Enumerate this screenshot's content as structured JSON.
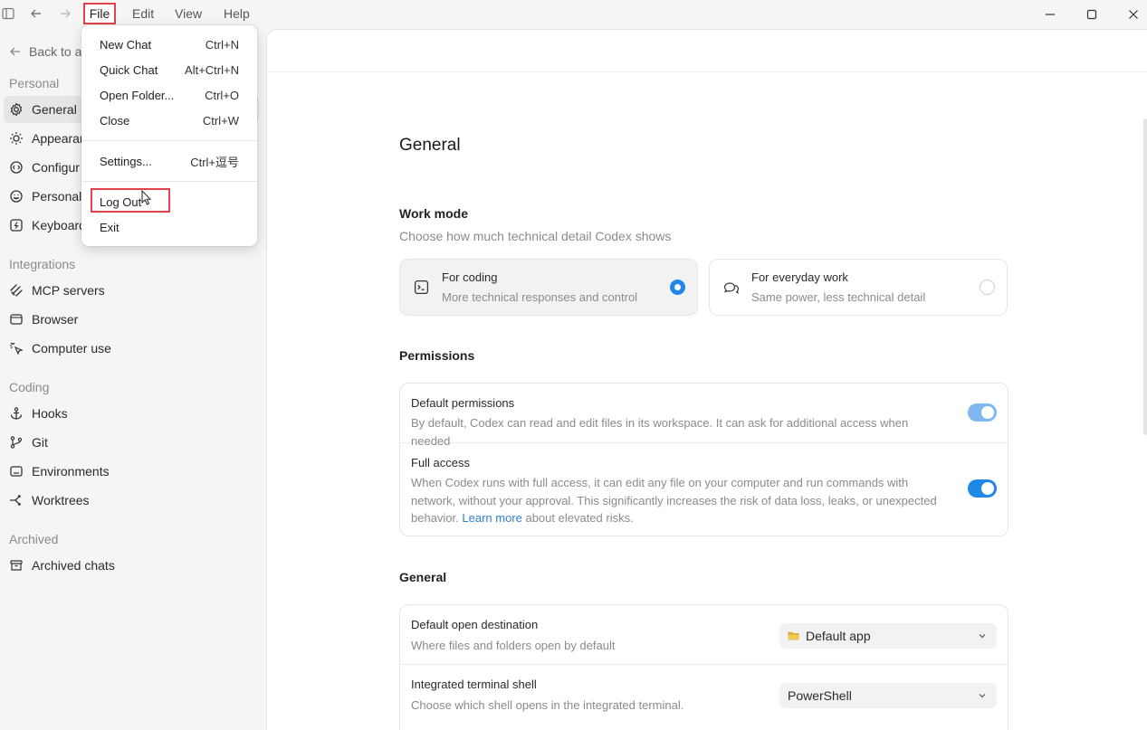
{
  "menubar": {
    "file": "File",
    "edit": "Edit",
    "view": "View",
    "help": "Help"
  },
  "file_menu": {
    "items": [
      {
        "label": "New Chat",
        "shortcut": "Ctrl+N"
      },
      {
        "label": "Quick Chat",
        "shortcut": "Alt+Ctrl+N"
      },
      {
        "label": "Open Folder...",
        "shortcut": "Ctrl+O"
      },
      {
        "label": "Close",
        "shortcut": "Ctrl+W"
      },
      {
        "label": "Settings...",
        "shortcut": "Ctrl+逗号"
      },
      {
        "label": "Log Out",
        "shortcut": ""
      },
      {
        "label": "Exit",
        "shortcut": ""
      }
    ]
  },
  "sidebar": {
    "back": "Back to a",
    "personal_label": "Personal",
    "personal": [
      {
        "label": "General",
        "icon": "gear-icon"
      },
      {
        "label": "Appearan",
        "icon": "sun-icon"
      },
      {
        "label": "Configur",
        "icon": "config-icon"
      },
      {
        "label": "Personali",
        "icon": "personalize-icon"
      },
      {
        "label": "Keyboard",
        "icon": "keyboard-icon"
      }
    ],
    "integrations_label": "Integrations",
    "integrations": [
      {
        "label": "MCP servers",
        "icon": "mcp-icon"
      },
      {
        "label": "Browser",
        "icon": "browser-icon"
      },
      {
        "label": "Computer use",
        "icon": "cursor-icon"
      }
    ],
    "coding_label": "Coding",
    "coding": [
      {
        "label": "Hooks",
        "icon": "anchor-icon"
      },
      {
        "label": "Git",
        "icon": "git-icon"
      },
      {
        "label": "Environments",
        "icon": "environment-icon"
      },
      {
        "label": "Worktrees",
        "icon": "worktree-icon"
      }
    ],
    "archived_label": "Archived",
    "archived": [
      {
        "label": "Archived chats",
        "icon": "archive-icon"
      }
    ]
  },
  "main": {
    "title": "General",
    "work_mode": {
      "heading": "Work mode",
      "subtitle": "Choose how much technical detail Codex shows",
      "coding_title": "For coding",
      "coding_desc": "More technical responses and control",
      "everyday_title": "For everyday work",
      "everyday_desc": "Same power, less technical detail"
    },
    "permissions": {
      "heading": "Permissions",
      "default_title": "Default permissions",
      "default_desc": "By default, Codex can read and edit files in its workspace. It can ask for additional access when needed",
      "full_title": "Full access",
      "full_desc_1": "When Codex runs with full access, it can edit any file on your computer and run commands with network, without your approval. This significantly increases the risk of data loss, leaks, or unexpected behavior. ",
      "full_link": "Learn more",
      "full_desc_2": " about elevated risks."
    },
    "general": {
      "heading": "General",
      "open_dest_title": "Default open destination",
      "open_dest_desc": "Where files and folders open by default",
      "open_dest_value": "Default app",
      "shell_title": "Integrated terminal shell",
      "shell_desc": "Choose which shell opens in the integrated terminal.",
      "shell_value": "PowerShell"
    }
  },
  "colors": {
    "accent": "#1f87e8",
    "toggle_dim": "#7fb8ee",
    "highlight": "#e0434b"
  }
}
